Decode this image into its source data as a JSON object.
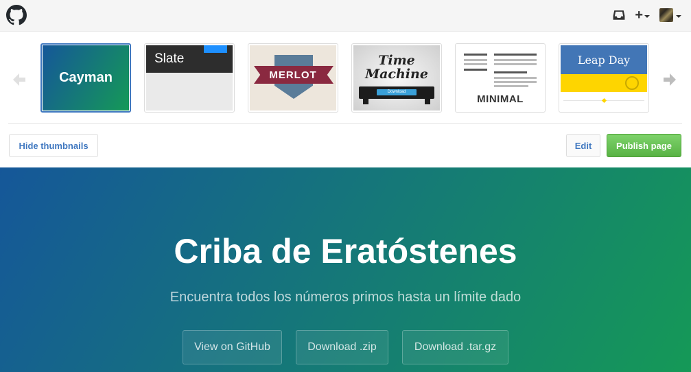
{
  "topbar": {
    "logo_icon": "github-octocat-icon",
    "inbox_icon": "inbox-icon",
    "new_menu_label": "+"
  },
  "themes": {
    "items": [
      {
        "name": "Cayman",
        "selected": true
      },
      {
        "name": "Slate",
        "selected": false
      },
      {
        "name": "MERLOT",
        "selected": false
      },
      {
        "name": "Time Machine",
        "button_label": "Download",
        "selected": false
      },
      {
        "name": "MINIMAL",
        "selected": false
      },
      {
        "name": "Leap Day",
        "selected": false
      }
    ],
    "hide_thumbnails_label": "Hide thumbnails",
    "edit_label": "Edit",
    "publish_label": "Publish page",
    "accent_color": "#4078c0",
    "publish_color": "#6cc644"
  },
  "hero": {
    "title": "Criba de Eratóstenes",
    "tagline": "Encuentra todos los números primos hasta un límite dado",
    "buttons": {
      "github": "View on GitHub",
      "zip": "Download .zip",
      "tar": "Download .tar.gz"
    },
    "gradient_start": "#155799",
    "gradient_end": "#159957"
  }
}
